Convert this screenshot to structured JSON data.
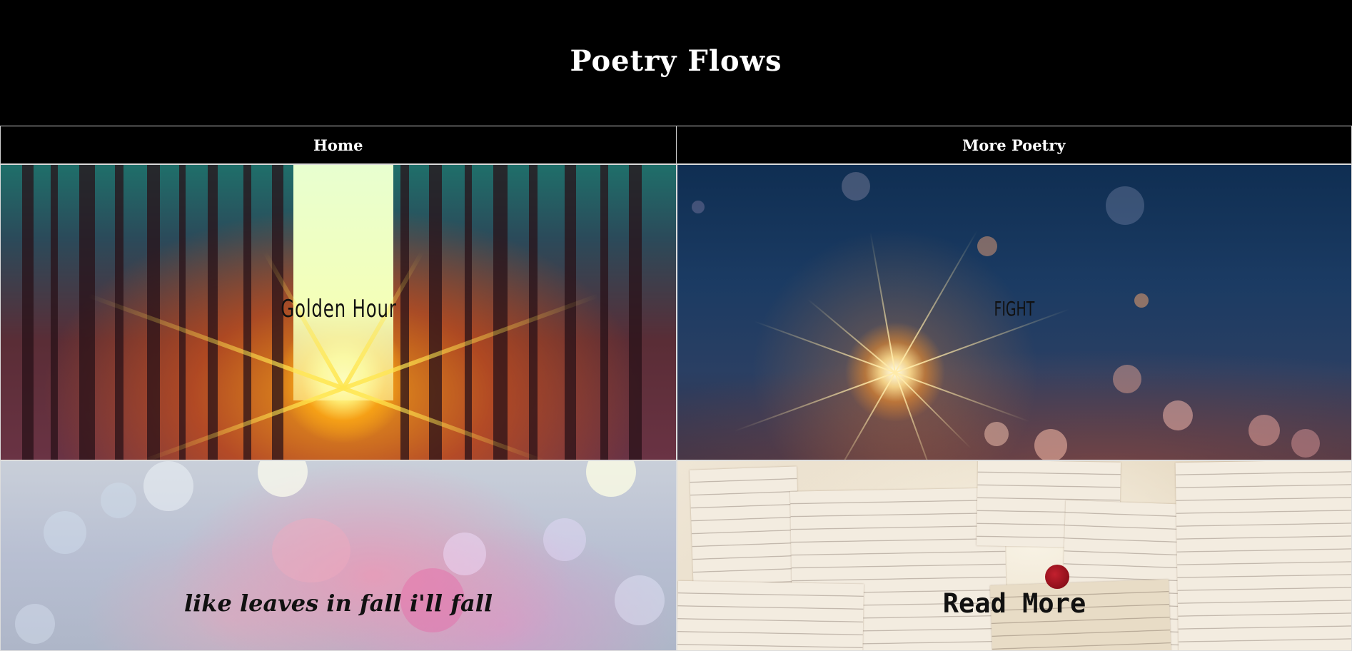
{
  "header": {
    "title": "Poetry Flows"
  },
  "nav": {
    "items": [
      {
        "label": "Home"
      },
      {
        "label": "More Poetry"
      }
    ]
  },
  "tiles": [
    {
      "label": "Golden Hour"
    },
    {
      "label": "FIGHT"
    },
    {
      "label": "like leaves in fall i'll fall"
    },
    {
      "label": "Read More"
    }
  ]
}
